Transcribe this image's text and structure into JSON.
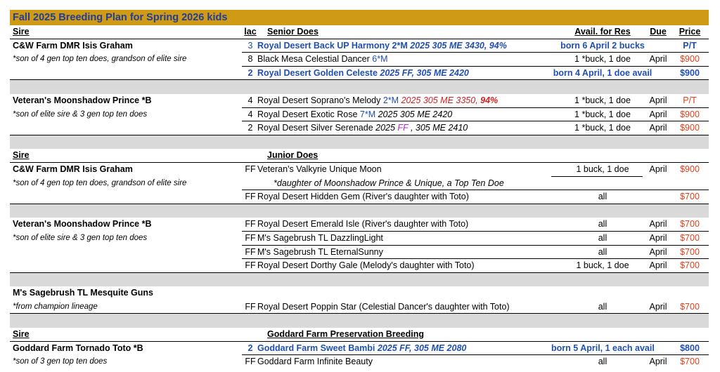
{
  "title": "Fall 2025 Breeding Plan for Spring 2026 kids",
  "headers1": {
    "sire": "Sire",
    "lac": "lac",
    "does": "Senior Does",
    "avail": "Avail. for Res",
    "due": "Due",
    "price": "Price"
  },
  "sire1": {
    "name": "C&W Farm DMR Isis Graham",
    "note": "*son of 4 gen top ten does, grandson of elite sire"
  },
  "s1r1": {
    "lac": "3",
    "doe": "Royal Desert Back UP Harmony 2*M ",
    "doe_it": "2025 305 ME 3430, 94%",
    "avail": "born 6 April 2 bucks",
    "price": "P/T"
  },
  "s1r2": {
    "lac": "8",
    "doe": "Black Mesa Celestial Dancer ",
    "doe_blue": "6*M",
    "avail": "1 *buck, 1 doe",
    "due": "April",
    "price": "$900"
  },
  "s1r3": {
    "lac": "2",
    "doe": "Royal Desert Golden Celeste ",
    "doe_it": "2025 FF, 305 ME 2420",
    "avail": "born 4 April, 1 doe avail",
    "price": "$900"
  },
  "sire2": {
    "name": "Veteran's Moonshadow Prince *B",
    "note": "*son of elite sire & 3 gen top ten does"
  },
  "s2r1": {
    "lac": "4",
    "doe": "Royal Desert Soprano's Melody ",
    "doe_blue": "2*M",
    "doe_red": " 2025 305 ME 3350, ",
    "doe_redb": "94%",
    "avail": "1 *buck, 1 doe",
    "due": "April",
    "price": "P/T"
  },
  "s2r2": {
    "lac": "4",
    "doe": "Royal Desert Exotic Rose ",
    "doe_blue": "7*M",
    "doe_it": " 2025 305 ME 2420",
    "avail": "1 *buck, 1 doe",
    "due": "April",
    "price": "$900"
  },
  "s2r3": {
    "lac": "2",
    "doe": "Royal Desert Silver Serenade ",
    "doe_it": "2025 ",
    "doe_purple": "FF",
    "doe_it2": " , 305 ME 2410",
    "avail": "1 *buck, 1 doe",
    "due": "April",
    "price": "$900"
  },
  "headers2": {
    "sire": "Sire",
    "does": "Junior Does"
  },
  "sire3": {
    "name": "C&W Farm DMR Isis Graham",
    "note": "*son of 4 gen top ten does, grandson of elite sire"
  },
  "s3r1": {
    "lac": "FF",
    "doe": "Veteran's Valkyrie Unique Moon",
    "avail": "1 buck, 1 doe",
    "due": "April",
    "price": "$900"
  },
  "s3note": "*daughter of Moonshadow Prince & Unique, a Top Ten Doe",
  "s3r2": {
    "lac": "FF",
    "doe": "Royal Desert Hidden Gem (River's daughter with Toto)",
    "avail": "all",
    "price": "$700"
  },
  "sire4": {
    "name": "Veteran's Moonshadow Prince *B",
    "note": "*son of elite sire & 3 gen top ten does"
  },
  "s4r1": {
    "lac": "FF",
    "doe": "Royal Desert Emerald Isle (River's daughter with Toto)",
    "avail": "all",
    "due": "April",
    "price": "$700"
  },
  "s4r2": {
    "lac": "FF",
    "doe": "M's Sagebrush TL DazzlingLight",
    "avail": "all",
    "due": "April",
    "price": "$700"
  },
  "s4r3": {
    "lac": "FF",
    "doe": "M's Sagebrush TL EternalSunny",
    "avail": "all",
    "due": "April",
    "price": "$700"
  },
  "s4r4": {
    "lac": "FF",
    "doe": "Royal Desert Dorthy Gale (Melody's daughter with Toto)",
    "avail": "1 buck, 1 doe",
    "due": "April",
    "price": "$700"
  },
  "sire5": {
    "name": "M's Sagebrush TL Mesquite Guns",
    "note": "*from champion lineage"
  },
  "s5r1": {
    "lac": "FF",
    "doe": "Royal Desert Poppin Star (Celestial Dancer's daughter with Toto)",
    "avail": "all",
    "due": "April",
    "price": "$700"
  },
  "headers3": {
    "sire": "Sire",
    "does": "Goddard Farm Preservation Breeding"
  },
  "sire6": {
    "name": "Goddard Farm Tornado Toto *B",
    "note": "*son of 3 gen top ten does"
  },
  "s6r1": {
    "lac": "2",
    "doe": "Goddard Farm Sweet Bambi ",
    "doe_it": "2025 FF, 305 ME 2080",
    "avail": "born 5 April, 1 each avail",
    "price": "$800"
  },
  "s6r2": {
    "lac": "FF",
    "doe": "Goddard Farm Infinite Beauty",
    "avail": "all",
    "due": "April",
    "price": "$700"
  },
  "colors": {
    "title_bg": "#cf9b17",
    "title_text": "#1f3d9a",
    "blue": "#1f4fb3",
    "red": "#e0401a",
    "gray_band": "#d9d9d9"
  }
}
